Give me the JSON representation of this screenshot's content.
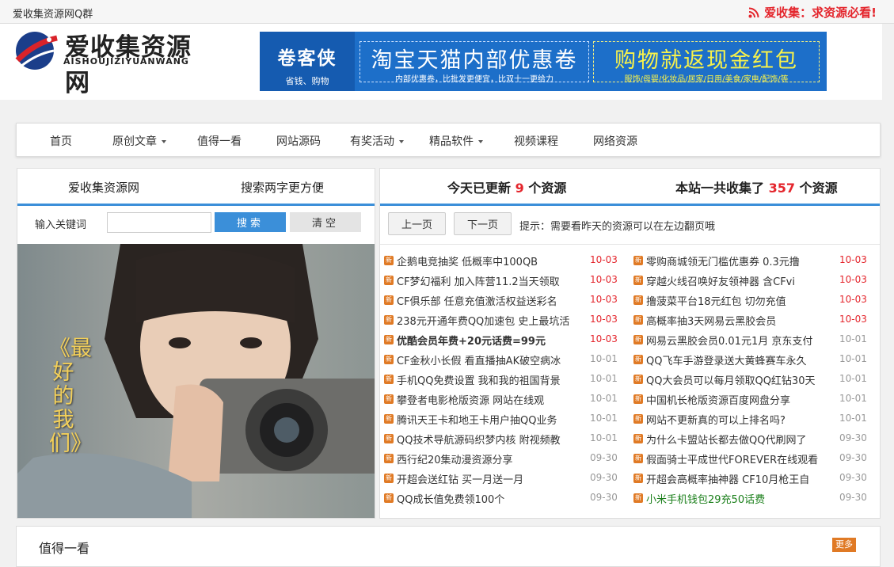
{
  "topbar": {
    "left_text": "爱收集资源网Q群",
    "right_text": "爱收集：求资源必看!"
  },
  "logo": {
    "cn": "爱收集资源网",
    "en": "AISHOUJIZIYUANWANG"
  },
  "banner": {
    "brand_title": "卷客侠",
    "brand_sub": "省钱、购物",
    "promo1_title": "淘宝天猫内部优惠卷",
    "promo1_sub": "内部优惠卷，比批发更便宜，比双十一更给力",
    "promo2_title": "购物就返现金红包",
    "promo2_sub": "服饰/母婴/化妆品/居家/日用/美食/家电/配饰/等"
  },
  "nav": {
    "items": [
      {
        "label": "首页",
        "dropdown": false
      },
      {
        "label": "原创文章",
        "dropdown": true
      },
      {
        "label": "值得一看",
        "dropdown": false
      },
      {
        "label": "网站源码",
        "dropdown": false
      },
      {
        "label": "有奖活动",
        "dropdown": true
      },
      {
        "label": "精品软件",
        "dropdown": true
      },
      {
        "label": "视频课程",
        "dropdown": false
      },
      {
        "label": "网络资源",
        "dropdown": false
      }
    ]
  },
  "left_panel": {
    "tab1": "爱收集资源网",
    "tab2": "搜索两字更方便",
    "search_label": "输入关键词",
    "search_value": "",
    "search_button": "搜索",
    "clear_button": "清空",
    "photo_caption": "《最好的我们》"
  },
  "right_panel": {
    "today_prefix": "今天已更新",
    "today_count": "9",
    "today_suffix": "个资源",
    "total_prefix": "本站一共收集了",
    "total_count": "357",
    "total_suffix": "个资源",
    "prev_button": "上一页",
    "next_button": "下一页",
    "tip": "提示：需要看昨天的资源可以在左边翻页哦",
    "icon_glyph": "新",
    "left_list": [
      {
        "title": "企鹅电竞抽奖 低概率中100QB",
        "date": "10-03",
        "new": true,
        "bold": false
      },
      {
        "title": "CF梦幻福利 加入阵营11.2当天领取",
        "date": "10-03",
        "new": true,
        "bold": false
      },
      {
        "title": "CF俱乐部 任意充值激活权益送彩名",
        "date": "10-03",
        "new": true,
        "bold": false
      },
      {
        "title": "238元开通年费QQ加速包 史上最坑活",
        "date": "10-03",
        "new": true,
        "bold": false
      },
      {
        "title": "优酷会员年费+20元话费=99元",
        "date": "10-03",
        "new": true,
        "bold": true
      },
      {
        "title": "CF金秋小长假 看直播抽AK破空病冰",
        "date": "10-01",
        "new": false,
        "bold": false
      },
      {
        "title": "手机QQ免费设置 我和我的祖国背景",
        "date": "10-01",
        "new": false,
        "bold": false
      },
      {
        "title": "攀登者电影枪版资源 网站在线观",
        "date": "10-01",
        "new": false,
        "bold": false
      },
      {
        "title": "腾讯天王卡和地王卡用户抽QQ业务",
        "date": "10-01",
        "new": false,
        "bold": false
      },
      {
        "title": "QQ技术导航源码织梦内核 附视频教",
        "date": "10-01",
        "new": false,
        "bold": false
      },
      {
        "title": "西行纪20集动漫资源分享",
        "date": "09-30",
        "new": false,
        "bold": false
      },
      {
        "title": "开超会送红钻 买一月送一月",
        "date": "09-30",
        "new": false,
        "bold": false
      },
      {
        "title": "QQ成长值免费领100个",
        "date": "09-30",
        "new": false,
        "bold": false
      }
    ],
    "right_list": [
      {
        "title": "零购商城领无门槛优惠券 0.3元撸",
        "date": "10-03",
        "new": true,
        "green": false
      },
      {
        "title": "穿越火线召唤好友领神器 含CFvi",
        "date": "10-03",
        "new": true,
        "green": false
      },
      {
        "title": "撸菠菜平台18元红包 切勿充值",
        "date": "10-03",
        "new": true,
        "green": false
      },
      {
        "title": "高概率抽3天网易云黑胶会员",
        "date": "10-03",
        "new": true,
        "green": false
      },
      {
        "title": "网易云黑胶会员0.01元1月 京东支付",
        "date": "10-01",
        "new": false,
        "green": false
      },
      {
        "title": "QQ飞车手游登录送大黄蜂赛车永久",
        "date": "10-01",
        "new": false,
        "green": false
      },
      {
        "title": "QQ大会员可以每月领取QQ红钻30天",
        "date": "10-01",
        "new": false,
        "green": false
      },
      {
        "title": "中国机长枪版资源百度网盘分享",
        "date": "10-01",
        "new": false,
        "green": false
      },
      {
        "title": "网站不更新真的可以上排名吗?",
        "date": "10-01",
        "new": false,
        "green": false
      },
      {
        "title": "为什么卡盟站长都去做QQ代刷网了",
        "date": "09-30",
        "new": false,
        "green": false
      },
      {
        "title": "假面骑士平成世代FOREVER在线观看",
        "date": "09-30",
        "new": false,
        "green": false
      },
      {
        "title": "开超会高概率抽神器 CF10月枪王自",
        "date": "09-30",
        "new": false,
        "green": false
      },
      {
        "title": "小米手机钱包29充50话费",
        "date": "09-30",
        "new": false,
        "green": true
      }
    ]
  },
  "bottom": {
    "title": "值得一看",
    "more": "更多"
  },
  "colors": {
    "accent_blue": "#3b8fd9",
    "red": "#e4252c",
    "icon_orange": "#e07a25",
    "green_link": "#1a7f1a"
  }
}
